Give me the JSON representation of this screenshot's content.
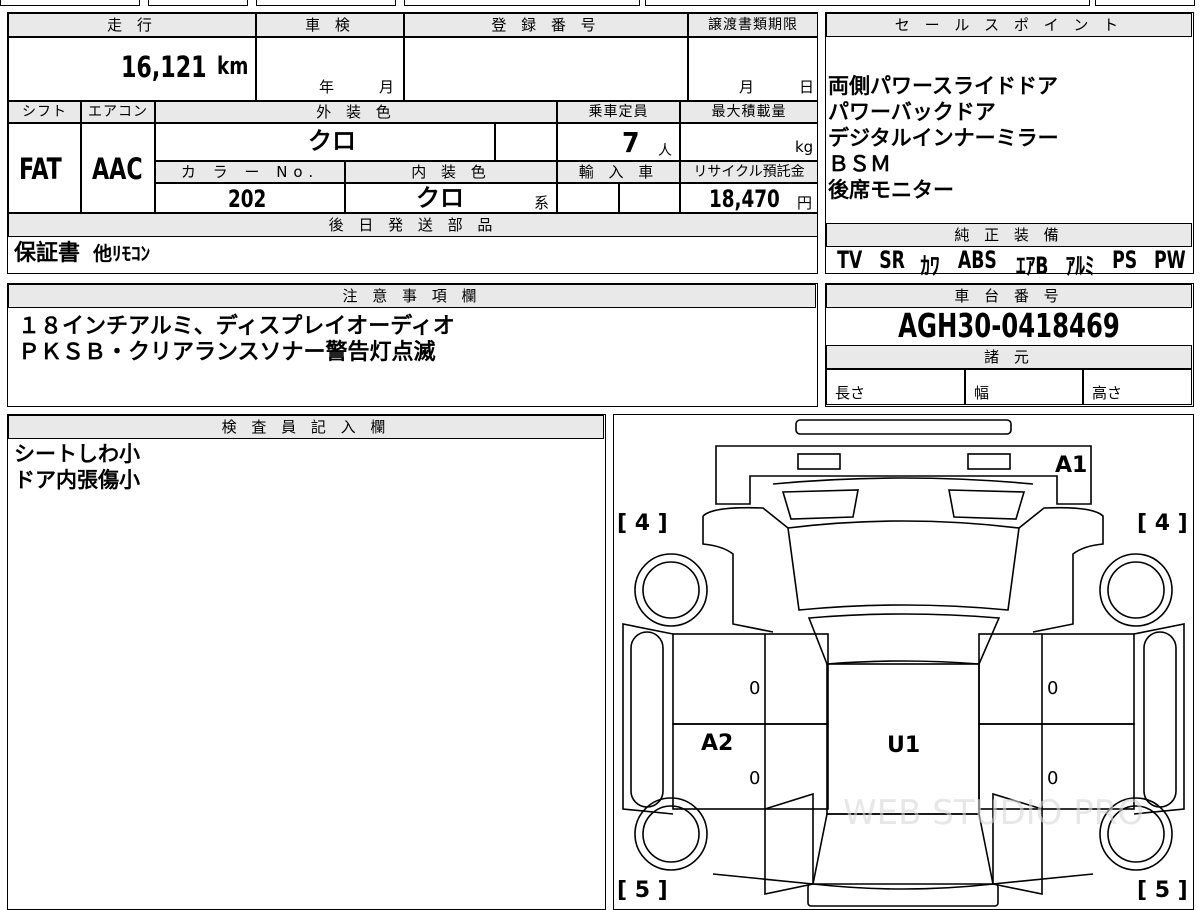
{
  "top": {
    "mileage_label": "走 行",
    "mileage_value": "16,121",
    "mileage_unit": "km",
    "inspection_label": "車 検",
    "inspection_year": "年",
    "inspection_month": "月",
    "registration_label": "登 録 番 号",
    "transfer_label": "譲渡書類期限",
    "transfer_month": "月",
    "transfer_day": "日"
  },
  "row2": {
    "shift_label": "シフト",
    "shift_value": "FAT",
    "ac_label": "エアコン",
    "ac_value": "AAC",
    "exterior_label": "外 装 色",
    "exterior_value": "クロ",
    "capacity_label": "乗車定員",
    "capacity_value": "7",
    "capacity_unit": "人",
    "maxload_label": "最大積載量",
    "maxload_unit": "kg",
    "colorno_label": "カ ラ ー No.",
    "colorno_value": "202",
    "interior_label": "内 装 色",
    "interior_value": "クロ",
    "interior_suffix": "系",
    "import_label": "輸 入 車",
    "recycle_label": "リサイクル預託金",
    "recycle_value": "18,470",
    "recycle_unit": "円"
  },
  "later_parts": {
    "label": "後 日 発 送 部 品",
    "value": "保証書",
    "value2": "他ﾘﾓｺﾝ"
  },
  "sales_points": {
    "label": "セ ー ル ス ポ イ ン ト",
    "items": [
      "両側パワースライドドア",
      "パワーバックドア",
      "デジタルインナーミラー",
      "ＢＳＭ",
      "後席モニター"
    ]
  },
  "standard_equipment": {
    "label": "純 正 装 備",
    "items": [
      "TV",
      "SR",
      "ｶﾜ",
      "ABS",
      "ｴｱB",
      "ｱﾙﾐ",
      "PS",
      "PW"
    ]
  },
  "notes": {
    "label": "注 意 事 項 欄",
    "lines": [
      "１８インチアルミ、ディスプレイオーディオ",
      "ＰＫＳＢ・クリアランスソナー警告灯点滅"
    ]
  },
  "chassis": {
    "label": "車 台 番 号",
    "value": "AGH30-0418469"
  },
  "specs": {
    "label": "諸 元",
    "length": "長さ",
    "width": "幅",
    "height": "高さ"
  },
  "inspector": {
    "label": "検 査 員 記 入 欄",
    "lines": [
      "シートしわ小",
      "ドア内張傷小"
    ]
  },
  "diagram": {
    "tire_front_left": "[ 4 ]",
    "tire_front_right": "[ 4 ]",
    "tire_rear_left": "[ 5 ]",
    "tire_rear_right": "[ 5 ]",
    "mark_front": "A1",
    "mark_side": "A2",
    "mark_roof": "U1",
    "door_count": "0",
    "watermark": "WEB STUDIO PRO"
  }
}
